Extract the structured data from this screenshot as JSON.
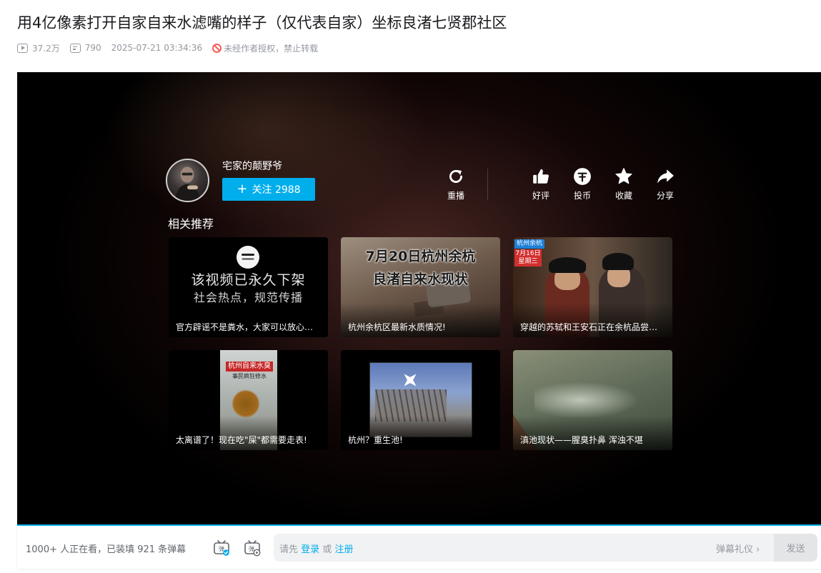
{
  "video": {
    "title": "用4亿像素打开自家自来水滤嘴的样子（仅代表自家）坐标良渚七贤郡社区",
    "views": "37.2万",
    "danmaku_count": "790",
    "publish_time": "2025-07-21 03:34:36",
    "copyright": "未经作者授权，禁止转载"
  },
  "end_screen": {
    "uploader": {
      "name": "宅家的颠野爷",
      "follow_label": "关注 2988"
    },
    "actions": {
      "replay": "重播",
      "like": "好评",
      "coin": "投币",
      "favorite": "收藏",
      "share": "分享"
    },
    "recommend_title": "相关推荐",
    "recommendations": [
      {
        "caption": "官方辟谣不是粪水，大家可以放心饮用",
        "thumb_line1": "该视频已永久下架",
        "thumb_line2": "社会热点，规范传播"
      },
      {
        "caption": "杭州余杭区最新水质情况!",
        "thumb_line1": "7月20日杭州余杭",
        "thumb_line2": "良渚自来水现状"
      },
      {
        "caption": "穿越的苏轼和王安石正在余杭品尝自来水",
        "tag": "杭州余杭",
        "date_tag_1": "7月16日",
        "date_tag_2": "星期三"
      },
      {
        "caption": "太离谱了！现在吃\"屎\"都需要走表!",
        "thumb_label": "杭州自来水臭",
        "thumb_sub": "事民疯狂修水"
      },
      {
        "caption": "杭州？重生池!"
      },
      {
        "caption": "滇池现状——腥臭扑鼻 浑浊不堪"
      }
    ]
  },
  "danmaku_bar": {
    "viewers": "1000+ 人正在看，已装填 921 条弹幕",
    "placeholder_prefix": "请先",
    "login": "登录",
    "or": "或",
    "register": "注册",
    "etiquette": "弹幕礼仪",
    "send": "发送"
  },
  "colors": {
    "accent": "#00aeec",
    "warning": "#f25d59"
  }
}
